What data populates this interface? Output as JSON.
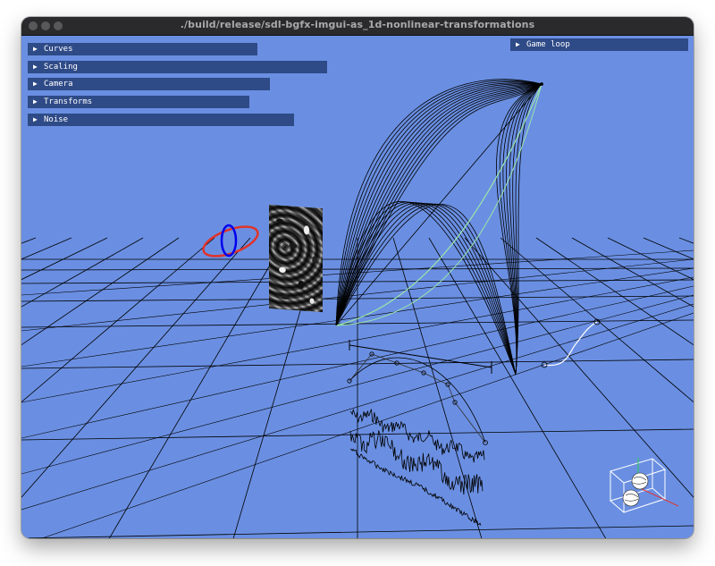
{
  "window": {
    "title": "./build/release/sdl-bgfx-imgui-as_1d-nonlinear-transformations"
  },
  "panels": [
    {
      "label": "Curves",
      "collapsed": true
    },
    {
      "label": "Scaling",
      "collapsed": true
    },
    {
      "label": "Camera",
      "collapsed": true
    },
    {
      "label": "Transforms",
      "collapsed": true
    },
    {
      "label": "Noise",
      "collapsed": true
    }
  ],
  "game_loop": {
    "label": "Game loop",
    "collapsed": true
  },
  "icons": {
    "collapsed_arrow": "▶"
  },
  "colors": {
    "background": "#6a8fe2",
    "grid": "#000000",
    "header": "#2e4a87",
    "highlight_curve": "#9be5a8",
    "ring_red": "#e0332b",
    "ring_blue": "#0000ee"
  }
}
